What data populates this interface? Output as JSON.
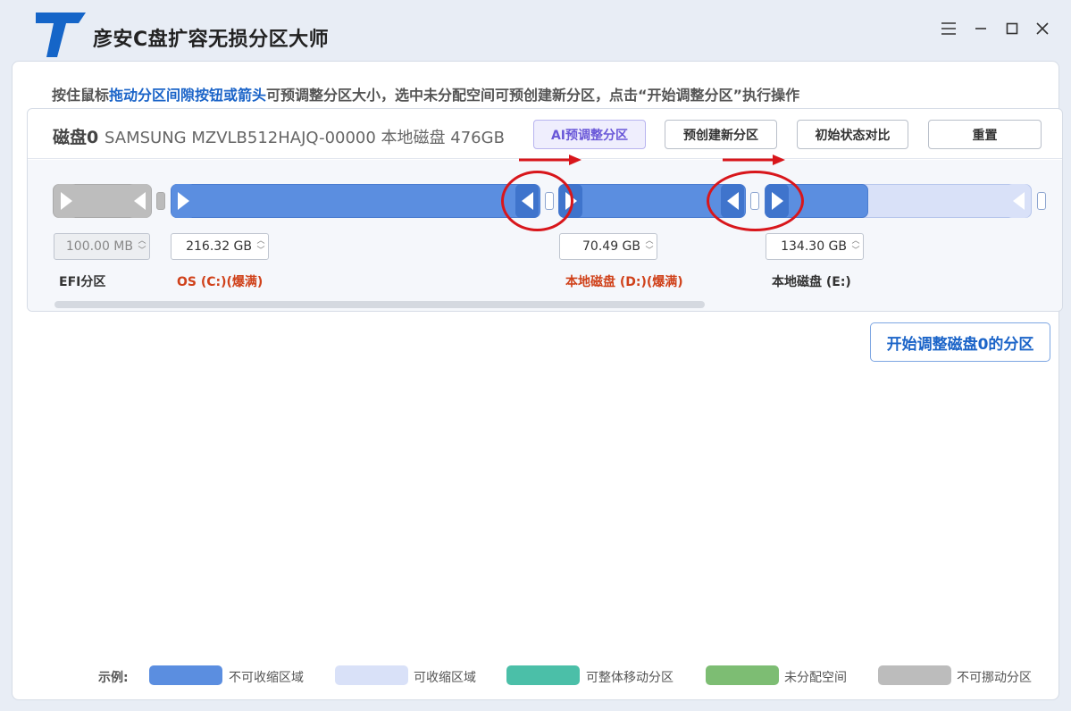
{
  "app": {
    "title": "彦安C盘扩容无损分区大师",
    "logo_letter": "T",
    "brand_color": "#1565c8"
  },
  "window_controls": {
    "menu_icon": "hamburger-icon",
    "minimize_icon": "minimize-icon",
    "maximize_icon": "maximize-icon",
    "close_icon": "close-icon"
  },
  "instruction": {
    "part1": "按住鼠标",
    "highlight": "拖动分区间隙按钮或箭头",
    "part2": "可预调整分区大小，选中未分配空间可预创建新分区，点击“开始调整分区”执行操作"
  },
  "disk": {
    "name": "磁盘0",
    "description": "SAMSUNG MZVLB512HAJQ-00000 本地磁盘 476GB",
    "buttons": {
      "ai_adjust": "AI预调整分区",
      "pre_create": "预创建新分区",
      "compare": "初始状态对比",
      "reset": "重置"
    },
    "partitions": [
      {
        "label": "EFI分区",
        "size": "100.00 MB",
        "color": "#333333",
        "editable": false
      },
      {
        "label": "OS (C:)(爆满)",
        "size": "216.32 GB",
        "color": "#d0421b",
        "editable": true
      },
      {
        "label": "本地磁盘 (D:)(爆满)",
        "size": "70.49 GB",
        "color": "#d0421b",
        "editable": true
      },
      {
        "label": "本地磁盘 (E:)",
        "size": "134.30 GB",
        "color": "#333333",
        "editable": true
      }
    ]
  },
  "start_button": "开始调整磁盘0的分区",
  "legend": {
    "title": "示例:",
    "items": [
      {
        "label": "不可收缩区域",
        "color": "#5b8ee0"
      },
      {
        "label": "可收缩区域",
        "color": "#d9e1f8"
      },
      {
        "label": "可整体移动分区",
        "color": "#4bbfa8"
      },
      {
        "label": "未分配空间",
        "color": "#7dbd73"
      },
      {
        "label": "不可挪动分区",
        "color": "#bcbcbc"
      }
    ]
  }
}
